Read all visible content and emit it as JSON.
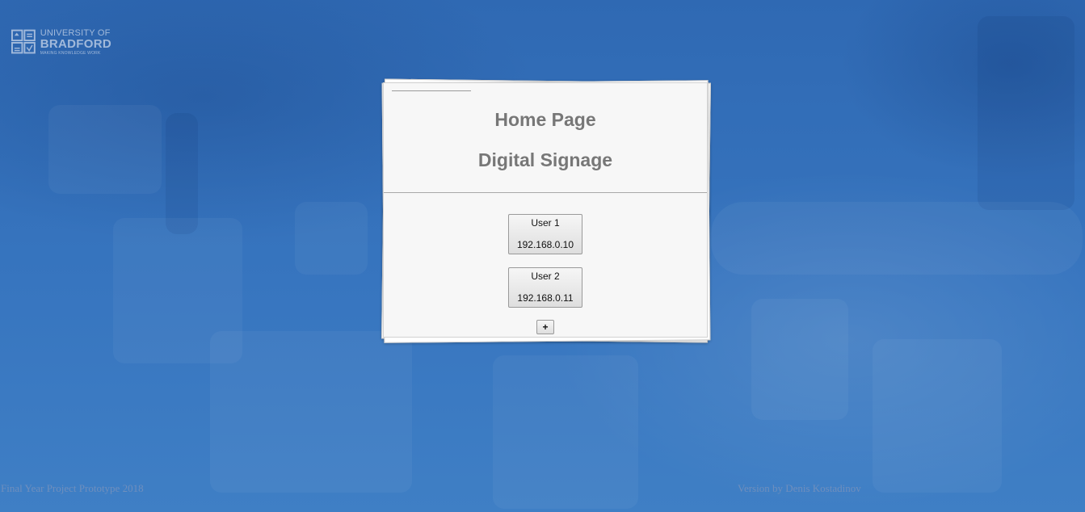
{
  "logo": {
    "line1": "UNIVERSITY OF",
    "line2": "BRADFORD",
    "line3": "MAKING KNOWLEDGE WORK",
    "icon": "university-crest-icon"
  },
  "card": {
    "title": "Home Page",
    "subtitle": "Digital Signage"
  },
  "users": [
    {
      "name": "User 1",
      "ip": "192.168.0.10"
    },
    {
      "name": "User 2",
      "ip": "192.168.0.11"
    }
  ],
  "add_label": "+",
  "footer": {
    "left": "Final Year Project Prototype 2018",
    "right": "Version by Denis Kostadinov"
  },
  "colors": {
    "background": "#3470b8",
    "card": "#f7f7f7",
    "heading": "#777777",
    "footer_text": "#6f8fbd"
  }
}
